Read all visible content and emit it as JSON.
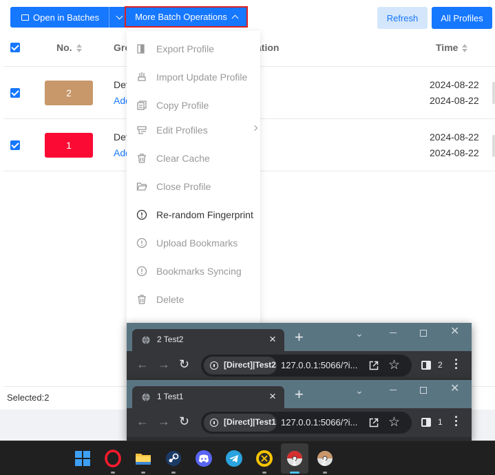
{
  "toolbar": {
    "open_in_batches": "Open in Batches",
    "more_batch_operations": "More Batch Operations",
    "refresh": "Refresh",
    "all_profiles": "All Profiles"
  },
  "table": {
    "col_no": "No.",
    "col_group": "Gro",
    "col_operation": "ation",
    "col_time": "Time",
    "rows": [
      {
        "badge": "2",
        "badge_color": "#c8976a",
        "group": "Def",
        "link": "Add",
        "time1": "2024-08-22",
        "time2": "2024-08-22"
      },
      {
        "badge": "1",
        "badge_color": "#fb0a33",
        "group": "Def",
        "link": "Add",
        "time1": "2024-08-22",
        "time2": "2024-08-22"
      }
    ],
    "selected": "Selected:2"
  },
  "menu": {
    "items": [
      {
        "label": "Export Profile",
        "icon": "export-icon",
        "enabled": false
      },
      {
        "label": "Import Update Profile",
        "icon": "import-icon",
        "enabled": false
      },
      {
        "label": "Copy Profile",
        "icon": "copy-icon",
        "enabled": false
      },
      {
        "label": "Edit Profiles",
        "icon": "edit-icon",
        "enabled": false
      },
      {
        "label": "Clear Cache",
        "icon": "trash-icon",
        "enabled": false
      },
      {
        "label": "Close Profile",
        "icon": "folder-icon",
        "enabled": false
      },
      {
        "label": "Re-random Fingerprint",
        "icon": "alert-circle-icon",
        "enabled": true
      },
      {
        "label": "Upload Bookmarks",
        "icon": "alert-circle-icon",
        "enabled": false
      },
      {
        "label": "Bookmarks Syncing",
        "icon": "alert-circle-icon",
        "enabled": false
      },
      {
        "label": "Delete",
        "icon": "trash-icon",
        "enabled": false
      }
    ]
  },
  "browsers": [
    {
      "tab_title": "2 Test2",
      "chip": "[Direct]|Test2",
      "url": "127.0.0.1:5066/?i...",
      "count": "2"
    },
    {
      "tab_title": "1 Test1",
      "chip": "[Direct]|Test1",
      "url": "127.0.0.1:5066/?i...",
      "count": "1"
    }
  ],
  "taskbar": {
    "apps": [
      "windows-start-icon",
      "opera-icon",
      "file-explorer-icon",
      "steam-icon",
      "discord-icon",
      "telegram-icon",
      "ix-icon",
      "profile-1-icon",
      "profile-2-icon"
    ],
    "profile_labels": [
      "1",
      "2"
    ]
  },
  "colors": {
    "primary": "#1677ff",
    "danger_outline": "#e02020"
  }
}
